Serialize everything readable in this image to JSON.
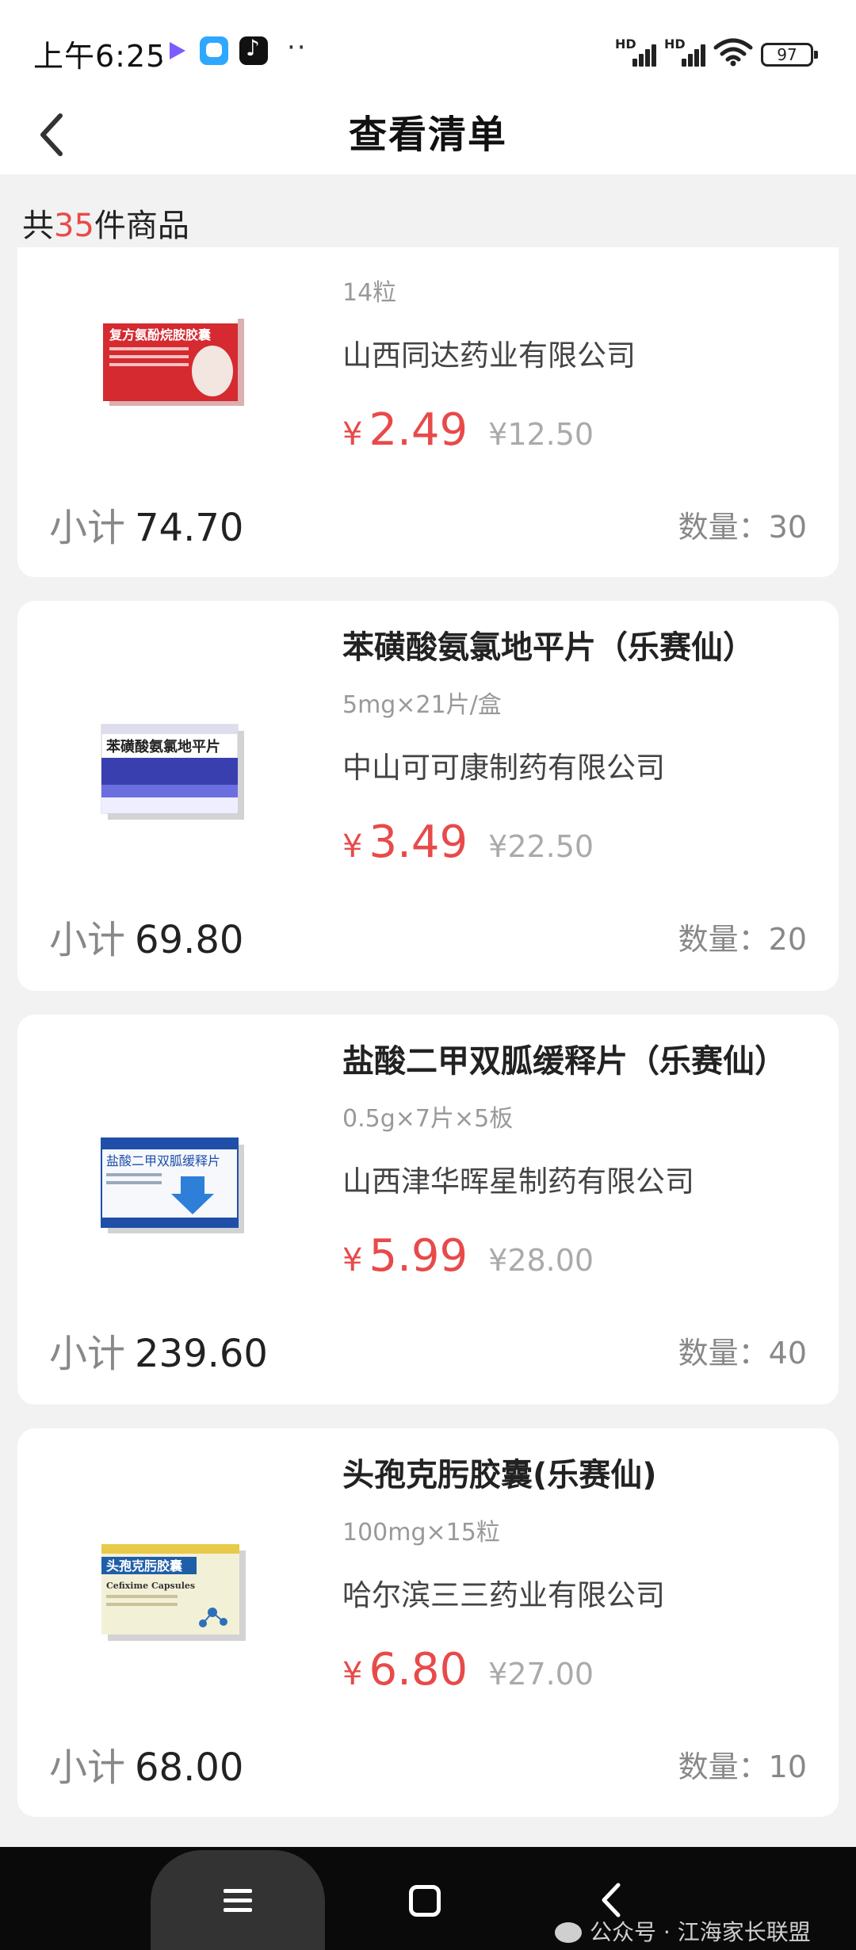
{
  "status_bar": {
    "time": "上午6:25",
    "signal_label": "HD",
    "battery": "97",
    "icons": [
      "video-app-icon",
      "chat-app-icon",
      "tiktok-app-icon",
      "more-dots-icon",
      "signal-icon",
      "wifi-icon",
      "battery-icon"
    ]
  },
  "header": {
    "title": "查看清单",
    "back_icon": "chevron-left-icon"
  },
  "summary": {
    "prefix": "共",
    "count": "35",
    "suffix": "件商品"
  },
  "products": [
    {
      "name": "",
      "spec": "14粒",
      "manufacturer": "山西同达药业有限公司",
      "price_symbol": "¥",
      "price": "2.49",
      "original_price": "¥12.50",
      "subtotal_label": "小计",
      "subtotal": "74.70",
      "quantity": "数量：30",
      "box_text": "复方氨酚烷胺胶囊",
      "box_color": "#c8202a"
    },
    {
      "name": "苯磺酸氨氯地平片（乐赛仙）",
      "spec": "5mg×21片/盒",
      "manufacturer": "中山可可康制药有限公司",
      "price_symbol": "¥",
      "price": "3.49",
      "original_price": "¥22.50",
      "subtotal_label": "小计",
      "subtotal": "69.80",
      "quantity": "数量：20",
      "box_text": "苯磺酸氨氯地平片",
      "box_color": "#3a3fb0"
    },
    {
      "name": "盐酸二甲双胍缓释片（乐赛仙）",
      "spec": "0.5g×7片×5板",
      "manufacturer": "山西津华晖星制药有限公司",
      "price_symbol": "¥",
      "price": "5.99",
      "original_price": "¥28.00",
      "subtotal_label": "小计",
      "subtotal": "239.60",
      "quantity": "数量：40",
      "box_text": "盐酸二甲双胍缓释片",
      "box_color": "#1f4fa8"
    },
    {
      "name": "头孢克肟胶囊(乐赛仙)",
      "spec": "100mg×15粒",
      "manufacturer": "哈尔滨三三药业有限公司",
      "price_symbol": "¥",
      "price": "6.80",
      "original_price": "¥27.00",
      "subtotal_label": "小计",
      "subtotal": "68.00",
      "quantity": "数量：10",
      "box_text": "头孢克肟胶囊",
      "box_sub": "Cefixime Capsules",
      "box_color": "#e8c94a"
    }
  ],
  "system_nav": {
    "icons": [
      "menu-icon",
      "home-square-icon",
      "back-chevron-icon"
    ]
  },
  "watermark": {
    "text": "公众号 · 江海家长联盟"
  },
  "colors": {
    "accent_red": "#e84a4a",
    "page_bg": "#f2f2f2",
    "card_bg": "#ffffff"
  }
}
